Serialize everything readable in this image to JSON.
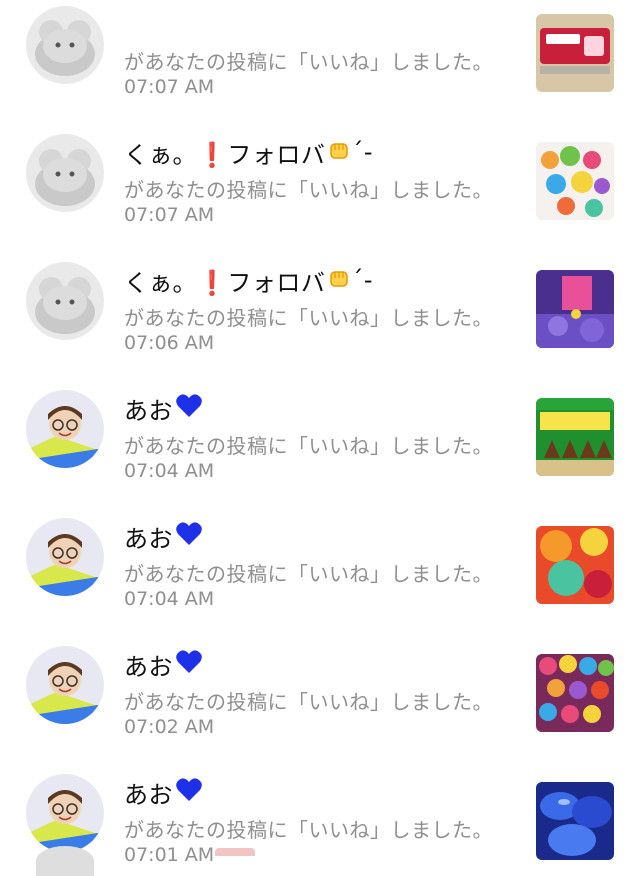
{
  "notifications": [
    {
      "user": "",
      "name_emoji": "",
      "avatar": "gray-cat-plush-avatar",
      "message": "があなたの投稿に「いいね」しました。",
      "time": "07:07 AM",
      "thumbnail": "red-candy-package-thumbnail"
    },
    {
      "user": "くぁ。❗フォロバ",
      "name_emoji": "raised-fist-emoji",
      "name_suffix": "´-",
      "avatar": "gray-cat-plush-avatar",
      "message": "があなたの投稿に「いいね」しました。",
      "time": "07:07 AM",
      "thumbnail": "colorful-sweets-thumbnail"
    },
    {
      "user": "くぁ。❗フォロバ",
      "name_emoji": "raised-fist-emoji",
      "name_suffix": "´-",
      "avatar": "gray-cat-plush-avatar",
      "message": "があなたの投稿に「いいね」しました。",
      "time": "07:06 AM",
      "thumbnail": "purple-night-illustration-thumbnail"
    },
    {
      "user": "あお",
      "name_emoji": "blue-heart-emoji",
      "name_suffix": "",
      "avatar": "glasses-boy-avatar",
      "message": "があなたの投稿に「いいね」しました。",
      "time": "07:04 AM",
      "thumbnail": "takenoko-no-sato-snack-thumbnail"
    },
    {
      "user": "あお",
      "name_emoji": "blue-heart-emoji",
      "name_suffix": "",
      "avatar": "glasses-boy-avatar",
      "message": "があなたの投稿に「いいね」しました。",
      "time": "07:04 AM",
      "thumbnail": "gummy-candy-thumbnail"
    },
    {
      "user": "あお",
      "name_emoji": "blue-heart-emoji",
      "name_suffix": "",
      "avatar": "glasses-boy-avatar",
      "message": "があなたの投稿に「いいね」しました。",
      "time": "07:02 AM",
      "thumbnail": "chocolate-candies-thumbnail"
    },
    {
      "user": "あお",
      "name_emoji": "blue-heart-emoji",
      "name_suffix": "",
      "avatar": "glasses-boy-avatar",
      "message": "があなたの投稿に「いいね」しました。",
      "time": "07:01 AM",
      "thumbnail": "blue-candy-thumbnail"
    }
  ],
  "colors": {
    "name_text": "#111111",
    "secondary_text": "#8f8f8f",
    "heart_blue": "#1f31e8",
    "exclamation_red": "#e02424"
  }
}
